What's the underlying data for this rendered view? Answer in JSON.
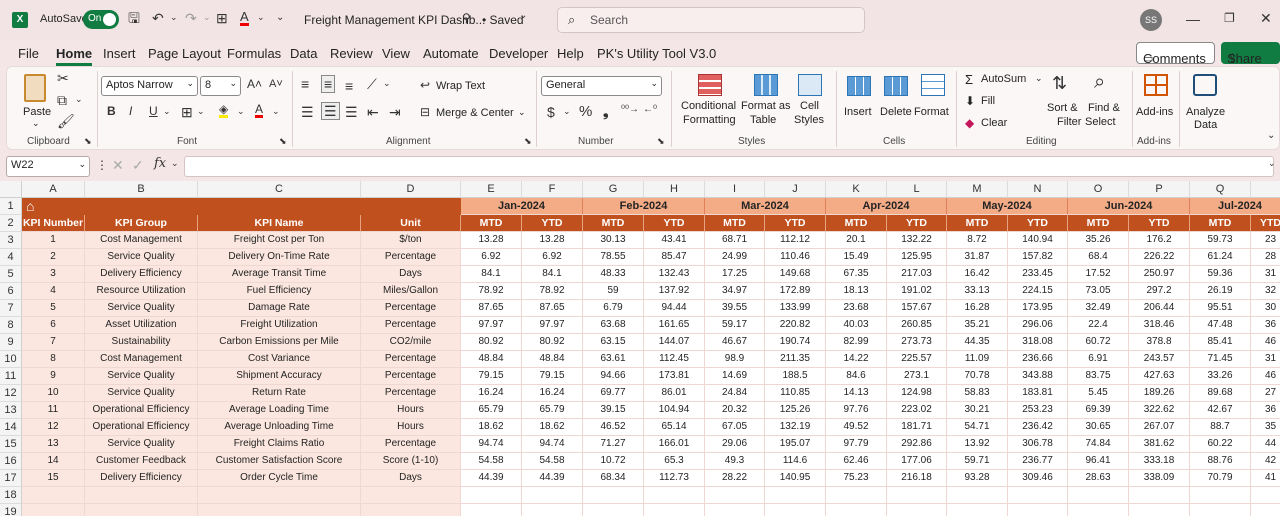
{
  "title": {
    "autosave": "AutoSave",
    "toggle": "On",
    "doc_name": "Freight Management KPI Dashb...",
    "saved": "• Saved",
    "search": "Search",
    "avatar": "SS"
  },
  "menu": [
    "File",
    "Home",
    "Insert",
    "Page Layout",
    "Formulas",
    "Data",
    "Review",
    "View",
    "Automate",
    "Developer",
    "Help",
    "PK's Utility Tool V3.0"
  ],
  "share": {
    "comments": "Comments",
    "share": "Share"
  },
  "ribbon": {
    "clipboard": {
      "paste": "Paste",
      "group": "Clipboard"
    },
    "font": {
      "name": "Aptos Narrow",
      "size": "8",
      "group": "Font"
    },
    "alignment": {
      "wrap": "Wrap Text",
      "merge": "Merge & Center",
      "group": "Alignment"
    },
    "number": {
      "format": "General",
      "group": "Number"
    },
    "styles": {
      "cond": "Conditional",
      "cond2": "Formatting",
      "fmt_as": "Format as",
      "table": "Table",
      "cell": "Cell",
      "cellstyles": "Styles",
      "group": "Styles"
    },
    "cells": {
      "insert": "Insert",
      "delete": "Delete",
      "format": "Format",
      "group": "Cells"
    },
    "editing": {
      "autosum": "AutoSum",
      "fill": "Fill",
      "clear": "Clear",
      "sort": "Sort &",
      "filter": "Filter",
      "find": "Find &",
      "select": "Select",
      "group": "Editing"
    },
    "addins": {
      "label": "Add-ins",
      "group": "Add-ins"
    },
    "analyze": {
      "l1": "Analyze",
      "l2": "Data"
    }
  },
  "formula_bar": {
    "name_box": "W22",
    "fx": "fx",
    "content": ""
  },
  "columns": [
    "A",
    "B",
    "C",
    "D",
    "E",
    "F",
    "G",
    "H",
    "I",
    "J",
    "K",
    "L",
    "M",
    "N",
    "O",
    "P",
    "Q"
  ],
  "rows": [
    "1",
    "2",
    "3",
    "4",
    "5",
    "6",
    "7",
    "8",
    "9",
    "10",
    "11",
    "12",
    "13",
    "14",
    "15",
    "16",
    "17",
    "18",
    "19"
  ],
  "months": [
    "Jan-2024",
    "Feb-2024",
    "Mar-2024",
    "Apr-2024",
    "May-2024",
    "Jun-2024",
    "Jul-2024"
  ],
  "headers": {
    "kpi_number": "KPI Number",
    "kpi_group": "KPI Group",
    "kpi_name": "KPI Name",
    "unit": "Unit",
    "mtd": "MTD",
    "ytd": "YTD"
  },
  "table": [
    [
      "1",
      "Cost Management",
      "Freight Cost per Ton",
      "$/ton",
      "13.28",
      "13.28",
      "30.13",
      "43.41",
      "68.71",
      "112.12",
      "20.1",
      "132.22",
      "8.72",
      "140.94",
      "35.26",
      "176.2",
      "59.73",
      "23"
    ],
    [
      "2",
      "Service Quality",
      "Delivery On-Time Rate",
      "Percentage",
      "6.92",
      "6.92",
      "78.55",
      "85.47",
      "24.99",
      "110.46",
      "15.49",
      "125.95",
      "31.87",
      "157.82",
      "68.4",
      "226.22",
      "61.24",
      "28"
    ],
    [
      "3",
      "Delivery Efficiency",
      "Average Transit Time",
      "Days",
      "84.1",
      "84.1",
      "48.33",
      "132.43",
      "17.25",
      "149.68",
      "67.35",
      "217.03",
      "16.42",
      "233.45",
      "17.52",
      "250.97",
      "59.36",
      "31"
    ],
    [
      "4",
      "Resource Utilization",
      "Fuel Efficiency",
      "Miles/Gallon",
      "78.92",
      "78.92",
      "59",
      "137.92",
      "34.97",
      "172.89",
      "18.13",
      "191.02",
      "33.13",
      "224.15",
      "73.05",
      "297.2",
      "26.19",
      "32"
    ],
    [
      "5",
      "Service Quality",
      "Damage Rate",
      "Percentage",
      "87.65",
      "87.65",
      "6.79",
      "94.44",
      "39.55",
      "133.99",
      "23.68",
      "157.67",
      "16.28",
      "173.95",
      "32.49",
      "206.44",
      "95.51",
      "30"
    ],
    [
      "6",
      "Asset Utilization",
      "Freight Utilization",
      "Percentage",
      "97.97",
      "97.97",
      "63.68",
      "161.65",
      "59.17",
      "220.82",
      "40.03",
      "260.85",
      "35.21",
      "296.06",
      "22.4",
      "318.46",
      "47.48",
      "36"
    ],
    [
      "7",
      "Sustainability",
      "Carbon Emissions per Mile",
      "CO2/mile",
      "80.92",
      "80.92",
      "63.15",
      "144.07",
      "46.67",
      "190.74",
      "82.99",
      "273.73",
      "44.35",
      "318.08",
      "60.72",
      "378.8",
      "85.41",
      "46"
    ],
    [
      "8",
      "Cost Management",
      "Cost Variance",
      "Percentage",
      "48.84",
      "48.84",
      "63.61",
      "112.45",
      "98.9",
      "211.35",
      "14.22",
      "225.57",
      "11.09",
      "236.66",
      "6.91",
      "243.57",
      "71.45",
      "31"
    ],
    [
      "9",
      "Service Quality",
      "Shipment Accuracy",
      "Percentage",
      "79.15",
      "79.15",
      "94.66",
      "173.81",
      "14.69",
      "188.5",
      "84.6",
      "273.1",
      "70.78",
      "343.88",
      "83.75",
      "427.63",
      "33.26",
      "46"
    ],
    [
      "10",
      "Service Quality",
      "Return Rate",
      "Percentage",
      "16.24",
      "16.24",
      "69.77",
      "86.01",
      "24.84",
      "110.85",
      "14.13",
      "124.98",
      "58.83",
      "183.81",
      "5.45",
      "189.26",
      "89.68",
      "27"
    ],
    [
      "11",
      "Operational Efficiency",
      "Average Loading Time",
      "Hours",
      "65.79",
      "65.79",
      "39.15",
      "104.94",
      "20.32",
      "125.26",
      "97.76",
      "223.02",
      "30.21",
      "253.23",
      "69.39",
      "322.62",
      "42.67",
      "36"
    ],
    [
      "12",
      "Operational Efficiency",
      "Average Unloading Time",
      "Hours",
      "18.62",
      "18.62",
      "46.52",
      "65.14",
      "67.05",
      "132.19",
      "49.52",
      "181.71",
      "54.71",
      "236.42",
      "30.65",
      "267.07",
      "88.7",
      "35"
    ],
    [
      "13",
      "Service Quality",
      "Freight Claims Ratio",
      "Percentage",
      "94.74",
      "94.74",
      "71.27",
      "166.01",
      "29.06",
      "195.07",
      "97.79",
      "292.86",
      "13.92",
      "306.78",
      "74.84",
      "381.62",
      "60.22",
      "44"
    ],
    [
      "14",
      "Customer Feedback",
      "Customer Satisfaction Score",
      "Score (1-10)",
      "54.58",
      "54.58",
      "10.72",
      "65.3",
      "49.3",
      "114.6",
      "62.46",
      "177.06",
      "59.71",
      "236.77",
      "96.41",
      "333.18",
      "88.76",
      "42"
    ],
    [
      "15",
      "Delivery Efficiency",
      "Order Cycle Time",
      "Days",
      "44.39",
      "44.39",
      "68.34",
      "112.73",
      "28.22",
      "140.95",
      "75.23",
      "216.18",
      "93.28",
      "309.46",
      "28.63",
      "338.09",
      "70.79",
      "41"
    ]
  ],
  "colors": {
    "header_dark": "#c0511f",
    "header_light": "#f3ac86",
    "row_fill": "#fbe7df",
    "excel_green": "#107c41"
  }
}
